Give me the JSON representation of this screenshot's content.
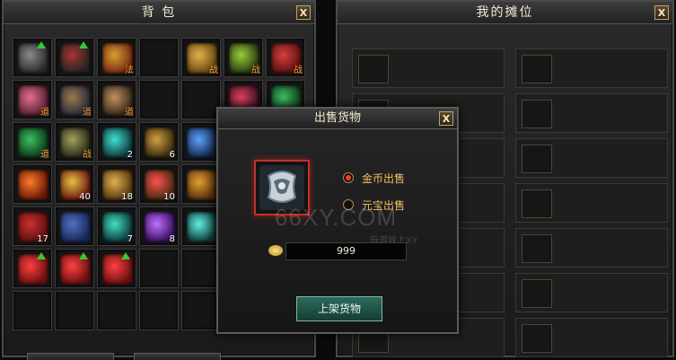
{
  "bag": {
    "title": "背  包",
    "close_label": "X",
    "items": [
      {
        "name": "dark-triangle-rune",
        "color": "#2b2b2b",
        "accent": "#8a8a8a",
        "tag": "",
        "count": "",
        "upgrade": true
      },
      {
        "name": "dark-triangle-rune-2",
        "color": "#232323",
        "accent": "#a33",
        "tag": "",
        "count": "",
        "upgrade": true
      },
      {
        "name": "fire-scroll",
        "color": "#7a2a10",
        "accent": "#d4a030",
        "tag": "法",
        "count": "",
        "upgrade": false
      },
      {
        "name": "empty",
        "color": "",
        "accent": "",
        "tag": "",
        "count": "",
        "upgrade": false
      },
      {
        "name": "golden-sword",
        "color": "#6b4a12",
        "accent": "#e2b14a",
        "tag": "战",
        "count": "",
        "upgrade": false
      },
      {
        "name": "green-helmet",
        "color": "#2a3a10",
        "accent": "#9acc3a",
        "tag": "战",
        "count": "",
        "upgrade": false
      },
      {
        "name": "red-blade",
        "color": "#5a1010",
        "accent": "#d84040",
        "tag": "战",
        "count": "",
        "upgrade": false
      },
      {
        "name": "pink-blade",
        "color": "#5a2030",
        "accent": "#e07090",
        "tag": "道",
        "count": "",
        "upgrade": false
      },
      {
        "name": "dark-ring",
        "color": "#2a2a3a",
        "accent": "#9a7a4a",
        "tag": "道",
        "count": "",
        "upgrade": false
      },
      {
        "name": "bone-whip",
        "color": "#3a2a1a",
        "accent": "#c09060",
        "tag": "道",
        "count": "",
        "upgrade": false
      },
      {
        "name": "empty",
        "color": "",
        "accent": "",
        "tag": "",
        "count": "",
        "upgrade": false
      },
      {
        "name": "empty",
        "color": "",
        "accent": "",
        "tag": "",
        "count": "",
        "upgrade": false
      },
      {
        "name": "bead-necklace",
        "color": "#3a1020",
        "accent": "#e04060",
        "tag": "",
        "count": "",
        "upgrade": false
      },
      {
        "name": "jade-bracelet",
        "color": "#0e3a1a",
        "accent": "#3ac060",
        "tag": "",
        "count": "",
        "upgrade": false
      },
      {
        "name": "jade-ring",
        "color": "#0e3a1a",
        "accent": "#3ac060",
        "tag": "道",
        "count": "",
        "upgrade": false
      },
      {
        "name": "bone-claw",
        "color": "#2a2a1a",
        "accent": "#a0a060",
        "tag": "战",
        "count": "",
        "upgrade": false
      },
      {
        "name": "cyan-crystal",
        "color": "#0e3a3a",
        "accent": "#40e0d0",
        "tag": "",
        "count": "2",
        "upgrade": false
      },
      {
        "name": "ginseng-root",
        "color": "#3a2a10",
        "accent": "#d0a040",
        "tag": "",
        "count": "6",
        "upgrade": false
      },
      {
        "name": "blue-potion",
        "color": "#102a4a",
        "accent": "#60a0ff",
        "tag": "",
        "count": "",
        "upgrade": false
      },
      {
        "name": "empty",
        "color": "",
        "accent": "",
        "tag": "",
        "count": "",
        "upgrade": false
      },
      {
        "name": "empty",
        "color": "",
        "accent": "",
        "tag": "",
        "count": "",
        "upgrade": false
      },
      {
        "name": "fire-orb",
        "color": "#6a1a08",
        "accent": "#ff7a2a",
        "tag": "",
        "count": "",
        "upgrade": false
      },
      {
        "name": "fortune-bag",
        "color": "#6a1a10",
        "accent": "#e8c040",
        "tag": "",
        "count": "40",
        "upgrade": false
      },
      {
        "name": "ancient-scroll",
        "color": "#5a3a10",
        "accent": "#e0b050",
        "tag": "",
        "count": "18",
        "upgrade": false
      },
      {
        "name": "demon-mask",
        "color": "#4a2a10",
        "accent": "#ff5050",
        "tag": "",
        "count": "10",
        "upgrade": false
      },
      {
        "name": "tiger-mask",
        "color": "#5a3010",
        "accent": "#e0a030",
        "tag": "",
        "count": "",
        "upgrade": false
      },
      {
        "name": "empty",
        "color": "",
        "accent": "",
        "tag": "",
        "count": "",
        "upgrade": false
      },
      {
        "name": "empty",
        "color": "",
        "accent": "",
        "tag": "",
        "count": "",
        "upgrade": false
      },
      {
        "name": "red-book",
        "color": "#5a1010",
        "accent": "#d03030",
        "tag": "",
        "count": "17",
        "upgrade": false
      },
      {
        "name": "blue-book",
        "color": "#1a2a5a",
        "accent": "#5070c0",
        "tag": "",
        "count": "",
        "upgrade": false
      },
      {
        "name": "cyan-shard",
        "color": "#0e3a3a",
        "accent": "#40e0c0",
        "tag": "",
        "count": "7",
        "upgrade": false
      },
      {
        "name": "purple-crystal",
        "color": "#3a1060",
        "accent": "#c070ff",
        "tag": "",
        "count": "8",
        "upgrade": false
      },
      {
        "name": "teal-orb",
        "color": "#0e3a3a",
        "accent": "#60f0e0",
        "tag": "",
        "count": "",
        "upgrade": false
      },
      {
        "name": "empty",
        "color": "",
        "accent": "",
        "tag": "",
        "count": "",
        "upgrade": false
      },
      {
        "name": "empty",
        "color": "",
        "accent": "",
        "tag": "",
        "count": "",
        "upgrade": false
      },
      {
        "name": "red-feather",
        "color": "#6a1010",
        "accent": "#ff4040",
        "tag": "",
        "count": "",
        "upgrade": true
      },
      {
        "name": "red-feather-2",
        "color": "#6a1010",
        "accent": "#ff4040",
        "tag": "",
        "count": "",
        "upgrade": true
      },
      {
        "name": "red-feather-3",
        "color": "#6a1010",
        "accent": "#ff4040",
        "tag": "",
        "count": "",
        "upgrade": true
      },
      {
        "name": "empty",
        "color": "",
        "accent": "",
        "tag": "",
        "count": "",
        "upgrade": false
      },
      {
        "name": "empty",
        "color": "",
        "accent": "",
        "tag": "",
        "count": "",
        "upgrade": false
      },
      {
        "name": "empty",
        "color": "",
        "accent": "",
        "tag": "",
        "count": "",
        "upgrade": false
      },
      {
        "name": "empty",
        "color": "",
        "accent": "",
        "tag": "",
        "count": "",
        "upgrade": false
      },
      {
        "name": "empty",
        "color": "",
        "accent": "",
        "tag": "",
        "count": "",
        "upgrade": false
      },
      {
        "name": "empty",
        "color": "",
        "accent": "",
        "tag": "",
        "count": "",
        "upgrade": false
      },
      {
        "name": "empty",
        "color": "",
        "accent": "",
        "tag": "",
        "count": "",
        "upgrade": false
      },
      {
        "name": "empty",
        "color": "",
        "accent": "",
        "tag": "",
        "count": "",
        "upgrade": false
      },
      {
        "name": "empty",
        "color": "",
        "accent": "",
        "tag": "",
        "count": "",
        "upgrade": false
      },
      {
        "name": "empty",
        "color": "",
        "accent": "",
        "tag": "",
        "count": "",
        "upgrade": false
      },
      {
        "name": "empty",
        "color": "",
        "accent": "",
        "tag": "",
        "count": "",
        "upgrade": false
      }
    ]
  },
  "stall": {
    "title": "我的摊位",
    "close_label": "X"
  },
  "sell_dialog": {
    "title": "出售货物",
    "close_label": "X",
    "item_name": "silver-dragon-armor",
    "option_gold": "金币出售",
    "option_yuanbao": "元宝出售",
    "selected_option": "gold",
    "price": "999",
    "submit_label": "上架货物"
  },
  "watermark": {
    "text": "66XY.COM",
    "subtext": "玩游戏上XY"
  }
}
